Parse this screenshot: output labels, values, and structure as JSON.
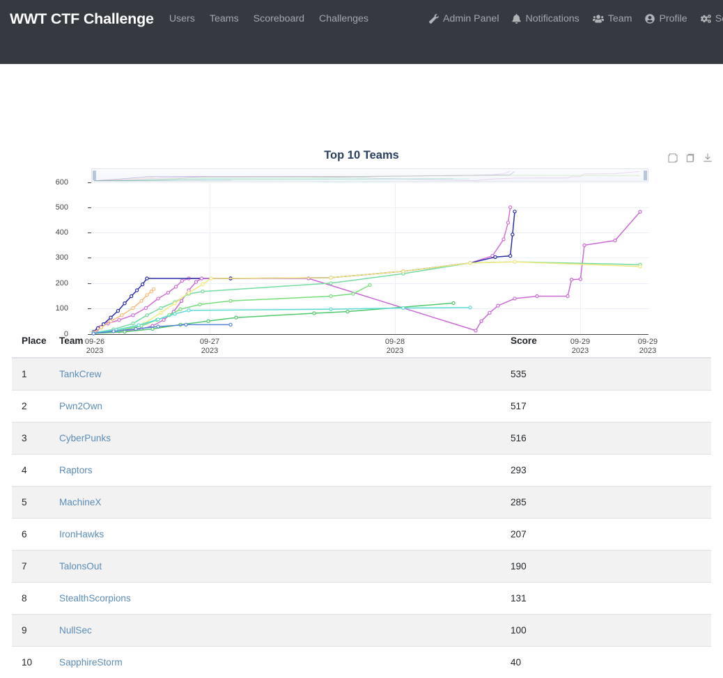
{
  "navbar": {
    "brand": "WWT CTF Challenge",
    "links": [
      {
        "label": "Users",
        "name": "nav-link-users"
      },
      {
        "label": "Teams",
        "name": "nav-link-teams"
      },
      {
        "label": "Scoreboard",
        "name": "nav-link-scoreboard"
      },
      {
        "label": "Challenges",
        "name": "nav-link-challenges"
      }
    ],
    "right_items": [
      {
        "label": "Admin Panel",
        "icon": "wrench-icon"
      },
      {
        "label": "Notifications",
        "icon": "bell-icon"
      },
      {
        "label": "Team",
        "icon": "users-icon"
      },
      {
        "label": "Profile",
        "icon": "user-circle-icon"
      },
      {
        "label": "Settings",
        "icon": "gears-icon"
      },
      {
        "label": "",
        "icon": "sign-out-icon"
      }
    ],
    "background_color": "#343a40",
    "link_color": "rgba(255,255,255,0.55)"
  },
  "chart_toolbar": {
    "buttons": [
      {
        "label": "Autoscale",
        "icon": "autoscale-icon"
      },
      {
        "label": "Reset axes",
        "icon": "reset-axes-icon"
      },
      {
        "label": "Download plot as a png",
        "icon": "download-icon"
      }
    ]
  },
  "chart_data": {
    "type": "line",
    "title": "Top 10 Teams",
    "xlabel": "",
    "ylabel": "",
    "grid": true,
    "legend_position": "bottom",
    "ylim": [
      0,
      640
    ],
    "yticks": [
      0,
      100,
      200,
      300,
      400,
      500,
      600
    ],
    "xticks": [
      "09-26\n2023",
      "09-27\n2023",
      "09-28\n2023",
      "09-29\n2023",
      "09-29\n2023"
    ],
    "xtick_labels": [
      {
        "date": "09-26",
        "year": "2023"
      },
      {
        "date": "09-27",
        "year": "2023"
      },
      {
        "date": "09-28",
        "year": "2023"
      },
      {
        "date": "09-29",
        "year": "2023"
      },
      {
        "date": "09-29",
        "year": "2023"
      }
    ],
    "rangeslider": true,
    "series": [
      {
        "name": "TankCrew",
        "color": "#d26fd6",
        "final_value": 535,
        "points": [
          {
            "x": 0.004,
            "y": 8
          },
          {
            "x": 0.01,
            "y": 18
          },
          {
            "x": 0.016,
            "y": 30
          },
          {
            "x": 0.03,
            "y": 45
          },
          {
            "x": 0.05,
            "y": 60
          },
          {
            "x": 0.075,
            "y": 80
          },
          {
            "x": 0.098,
            "y": 110
          },
          {
            "x": 0.12,
            "y": 150
          },
          {
            "x": 0.138,
            "y": 175
          },
          {
            "x": 0.152,
            "y": 200
          },
          {
            "x": 0.163,
            "y": 225
          },
          {
            "x": 0.175,
            "y": 235
          },
          {
            "x": 0.25,
            "y": 235
          },
          {
            "x": 0.43,
            "y": 238
          },
          {
            "x": 0.56,
            "y": 265
          },
          {
            "x": 0.68,
            "y": 300
          },
          {
            "x": 0.72,
            "y": 330
          },
          {
            "x": 0.74,
            "y": 400
          },
          {
            "x": 0.748,
            "y": 470
          },
          {
            "x": 0.752,
            "y": 535
          }
        ]
      },
      {
        "name": "Pwn2Own",
        "color": "#2b2ba8",
        "final_value": 517,
        "points": [
          {
            "x": 0.004,
            "y": 10
          },
          {
            "x": 0.012,
            "y": 25
          },
          {
            "x": 0.022,
            "y": 42
          },
          {
            "x": 0.035,
            "y": 70
          },
          {
            "x": 0.048,
            "y": 98
          },
          {
            "x": 0.06,
            "y": 130
          },
          {
            "x": 0.072,
            "y": 160
          },
          {
            "x": 0.082,
            "y": 185
          },
          {
            "x": 0.092,
            "y": 210
          },
          {
            "x": 0.1,
            "y": 235
          },
          {
            "x": 0.25,
            "y": 235
          },
          {
            "x": 0.43,
            "y": 238
          },
          {
            "x": 0.56,
            "y": 265
          },
          {
            "x": 0.68,
            "y": 300
          },
          {
            "x": 0.725,
            "y": 325
          },
          {
            "x": 0.752,
            "y": 330
          },
          {
            "x": 0.756,
            "y": 420
          },
          {
            "x": 0.76,
            "y": 517
          }
        ]
      },
      {
        "name": "CyberPunks",
        "color": "#c96ad4",
        "final_value": 516,
        "points": [
          {
            "x": 0.004,
            "y": 5
          },
          {
            "x": 0.05,
            "y": 12
          },
          {
            "x": 0.09,
            "y": 22
          },
          {
            "x": 0.11,
            "y": 35
          },
          {
            "x": 0.13,
            "y": 60
          },
          {
            "x": 0.148,
            "y": 95
          },
          {
            "x": 0.162,
            "y": 140
          },
          {
            "x": 0.175,
            "y": 185
          },
          {
            "x": 0.188,
            "y": 220
          },
          {
            "x": 0.198,
            "y": 235
          },
          {
            "x": 0.39,
            "y": 235
          },
          {
            "x": 0.69,
            "y": 15
          },
          {
            "x": 0.7,
            "y": 55
          },
          {
            "x": 0.715,
            "y": 90
          },
          {
            "x": 0.73,
            "y": 120
          },
          {
            "x": 0.76,
            "y": 150
          },
          {
            "x": 0.8,
            "y": 160
          },
          {
            "x": 0.855,
            "y": 160
          },
          {
            "x": 0.862,
            "y": 230
          },
          {
            "x": 0.878,
            "y": 232
          },
          {
            "x": 0.885,
            "y": 375
          },
          {
            "x": 0.94,
            "y": 395
          },
          {
            "x": 0.985,
            "y": 516
          }
        ]
      },
      {
        "name": "Raptors",
        "color": "#74dba0",
        "final_value": 293,
        "points": [
          {
            "x": 0.004,
            "y": 5
          },
          {
            "x": 0.04,
            "y": 20
          },
          {
            "x": 0.075,
            "y": 45
          },
          {
            "x": 0.1,
            "y": 80
          },
          {
            "x": 0.125,
            "y": 110
          },
          {
            "x": 0.15,
            "y": 135
          },
          {
            "x": 0.175,
            "y": 170
          },
          {
            "x": 0.2,
            "y": 180
          },
          {
            "x": 0.43,
            "y": 215
          },
          {
            "x": 0.56,
            "y": 255
          },
          {
            "x": 0.68,
            "y": 300
          },
          {
            "x": 0.76,
            "y": 305
          },
          {
            "x": 0.985,
            "y": 293
          }
        ]
      },
      {
        "name": "MachineX",
        "color": "#f0e87a",
        "final_value": 285,
        "points": [
          {
            "x": 0.004,
            "y": 4
          },
          {
            "x": 0.055,
            "y": 18
          },
          {
            "x": 0.095,
            "y": 45
          },
          {
            "x": 0.125,
            "y": 90
          },
          {
            "x": 0.15,
            "y": 130
          },
          {
            "x": 0.175,
            "y": 175
          },
          {
            "x": 0.2,
            "y": 210
          },
          {
            "x": 0.215,
            "y": 235
          },
          {
            "x": 0.43,
            "y": 238
          },
          {
            "x": 0.56,
            "y": 265
          },
          {
            "x": 0.68,
            "y": 300
          },
          {
            "x": 0.76,
            "y": 305
          },
          {
            "x": 0.985,
            "y": 285
          }
        ]
      },
      {
        "name": "IronHawks",
        "color": "#76dd7a",
        "final_value": 207,
        "points": [
          {
            "x": 0.004,
            "y": 4
          },
          {
            "x": 0.05,
            "y": 15
          },
          {
            "x": 0.09,
            "y": 35
          },
          {
            "x": 0.118,
            "y": 60
          },
          {
            "x": 0.14,
            "y": 80
          },
          {
            "x": 0.16,
            "y": 105
          },
          {
            "x": 0.195,
            "y": 125
          },
          {
            "x": 0.25,
            "y": 140
          },
          {
            "x": 0.43,
            "y": 160
          },
          {
            "x": 0.47,
            "y": 170
          },
          {
            "x": 0.5,
            "y": 207
          }
        ]
      },
      {
        "name": "TalonsOut",
        "color": "#f5bb7d",
        "final_value": 190,
        "points": [
          {
            "x": 0.004,
            "y": 8
          },
          {
            "x": 0.018,
            "y": 28
          },
          {
            "x": 0.035,
            "y": 55
          },
          {
            "x": 0.055,
            "y": 80
          },
          {
            "x": 0.075,
            "y": 110
          },
          {
            "x": 0.09,
            "y": 140
          },
          {
            "x": 0.1,
            "y": 165
          },
          {
            "x": 0.108,
            "y": 180
          },
          {
            "x": 0.112,
            "y": 190
          }
        ]
      },
      {
        "name": "StealthScorpions",
        "color": "#4cc96b",
        "final_value": 131,
        "points": [
          {
            "x": 0.004,
            "y": 3
          },
          {
            "x": 0.06,
            "y": 10
          },
          {
            "x": 0.11,
            "y": 22
          },
          {
            "x": 0.16,
            "y": 40
          },
          {
            "x": 0.21,
            "y": 55
          },
          {
            "x": 0.26,
            "y": 70
          },
          {
            "x": 0.4,
            "y": 88
          },
          {
            "x": 0.46,
            "y": 95
          },
          {
            "x": 0.65,
            "y": 131
          }
        ]
      },
      {
        "name": "NullSec",
        "color": "#5bdbd6",
        "final_value": 100,
        "points": [
          {
            "x": 0.004,
            "y": 4
          },
          {
            "x": 0.045,
            "y": 18
          },
          {
            "x": 0.085,
            "y": 38
          },
          {
            "x": 0.12,
            "y": 62
          },
          {
            "x": 0.15,
            "y": 85
          },
          {
            "x": 0.175,
            "y": 100
          },
          {
            "x": 0.43,
            "y": 105
          },
          {
            "x": 0.56,
            "y": 110
          },
          {
            "x": 0.68,
            "y": 112
          }
        ]
      },
      {
        "name": "SapphireStorm",
        "color": "#5580d8",
        "final_value": 40,
        "points": [
          {
            "x": 0.004,
            "y": 3
          },
          {
            "x": 0.04,
            "y": 12
          },
          {
            "x": 0.08,
            "y": 22
          },
          {
            "x": 0.12,
            "y": 32
          },
          {
            "x": 0.17,
            "y": 40
          },
          {
            "x": 0.25,
            "y": 40
          }
        ]
      }
    ]
  },
  "table": {
    "headers": {
      "place": "Place",
      "team": "Team",
      "score": "Score"
    },
    "rows": [
      {
        "place": "1",
        "team": "TankCrew",
        "score": "535"
      },
      {
        "place": "2",
        "team": "Pwn2Own",
        "score": "517"
      },
      {
        "place": "3",
        "team": "CyberPunks",
        "score": "516"
      },
      {
        "place": "4",
        "team": "Raptors",
        "score": "293"
      },
      {
        "place": "5",
        "team": "MachineX",
        "score": "285"
      },
      {
        "place": "6",
        "team": "IronHawks",
        "score": "207"
      },
      {
        "place": "7",
        "team": "TalonsOut",
        "score": "190"
      },
      {
        "place": "8",
        "team": "StealthScorpions",
        "score": "131"
      },
      {
        "place": "9",
        "team": "NullSec",
        "score": "100"
      },
      {
        "place": "10",
        "team": "SapphireStorm",
        "score": "40"
      }
    ]
  }
}
